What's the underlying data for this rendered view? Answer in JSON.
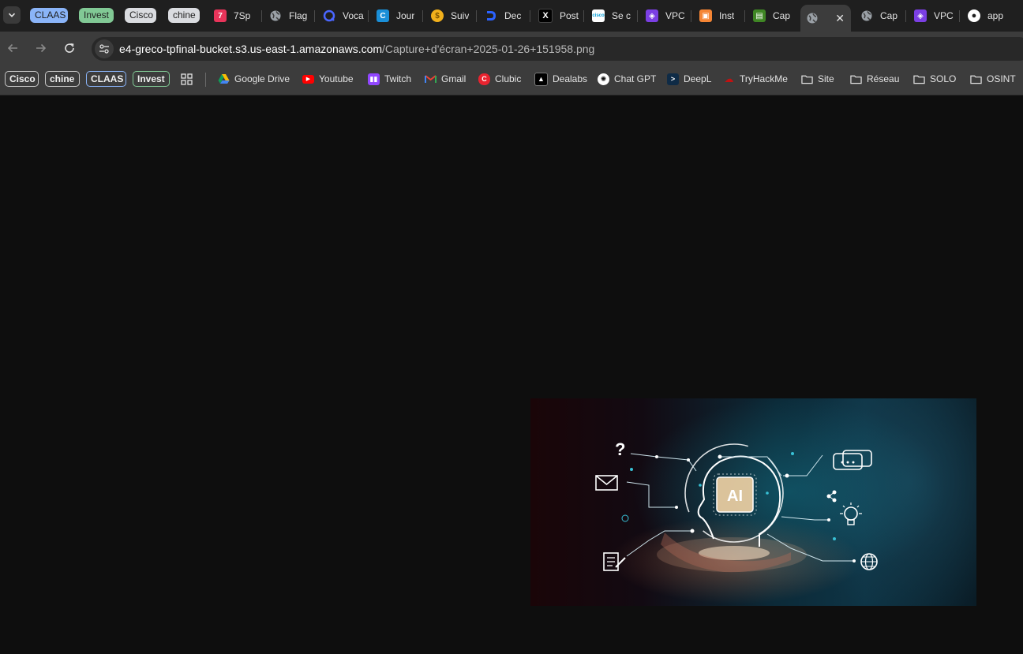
{
  "tab_groups": [
    {
      "label": "CLAAS",
      "color": "#8ab4f8",
      "text_color": "#1f1f1f"
    },
    {
      "label": "Invest",
      "color": "#81c995",
      "text_color": "#1f1f1f"
    },
    {
      "label": "Cisco",
      "color": "#dadce0",
      "text_color": "#1f1f1f"
    },
    {
      "label": "chine",
      "color": "#dadce0",
      "text_color": "#1f1f1f"
    }
  ],
  "tabs": [
    {
      "title": "7Sp",
      "icon": "7speaking-icon",
      "color": "#e8345a"
    },
    {
      "title": "Flag",
      "icon": "globe-icon",
      "color": "#5f6368"
    },
    {
      "title": "Voca",
      "icon": "voca-icon",
      "color": "#3a5bff"
    },
    {
      "title": "Jour",
      "icon": "journal-icon",
      "color": "#1a8fd8"
    },
    {
      "title": "Suiv",
      "icon": "coin-icon",
      "color": "#f2b11c"
    },
    {
      "title": "Dec",
      "icon": "dec-icon",
      "color": "#2b62ff"
    },
    {
      "title": "Post",
      "icon": "x-icon",
      "color": "#000000"
    },
    {
      "title": "Se c",
      "icon": "cisco-icon",
      "color": "#ffffff"
    },
    {
      "title": "VPC",
      "icon": "vpc-icon",
      "color": "#7b3fe4"
    },
    {
      "title": "Inst",
      "icon": "aws-instance-icon",
      "color": "#f58534"
    },
    {
      "title": "Cap",
      "icon": "capture-icon",
      "color": "#3f8624"
    },
    {
      "title": "",
      "icon": "globe-icon",
      "color": "#5f6368",
      "active": true
    },
    {
      "title": "Cap",
      "icon": "globe-icon",
      "color": "#5f6368"
    },
    {
      "title": "VPC",
      "icon": "vpc-icon",
      "color": "#7b3fe4"
    },
    {
      "title": "app",
      "icon": "github-icon",
      "color": "#1f1f1f"
    }
  ],
  "omnibox": {
    "host": "e4-greco-tpfinal-bucket.s3.us-east-1.amazonaws.com",
    "path": "/Capture+d'écran+2025-01-26+151958.png"
  },
  "bookmark_groups": [
    {
      "label": "Cisco",
      "color": "#c8c8c8"
    },
    {
      "label": "chine",
      "color": "#c8c8c8"
    },
    {
      "label": "CLAAS",
      "color": "#8ab4f8"
    },
    {
      "label": "Invest",
      "color": "#81c995"
    }
  ],
  "bookmarks": [
    {
      "label": "Google Drive",
      "icon": "google-drive-icon"
    },
    {
      "label": "Youtube",
      "icon": "youtube-icon"
    },
    {
      "label": "Twitch",
      "icon": "twitch-icon"
    },
    {
      "label": "Gmail",
      "icon": "gmail-icon"
    },
    {
      "label": "Clubic",
      "icon": "clubic-icon"
    },
    {
      "label": "Dealabs",
      "icon": "dealabs-icon"
    },
    {
      "label": "Chat GPT",
      "icon": "chatgpt-icon"
    },
    {
      "label": "DeepL",
      "icon": "deepl-icon"
    },
    {
      "label": "TryHackMe",
      "icon": "tryhackme-icon"
    },
    {
      "label": "Site",
      "icon": "folder-icon"
    },
    {
      "label": "Réseau",
      "icon": "folder-icon"
    },
    {
      "label": "SOLO",
      "icon": "folder-icon"
    },
    {
      "label": "OSINT",
      "icon": "folder-icon"
    }
  ],
  "image": {
    "badge": "AI"
  }
}
